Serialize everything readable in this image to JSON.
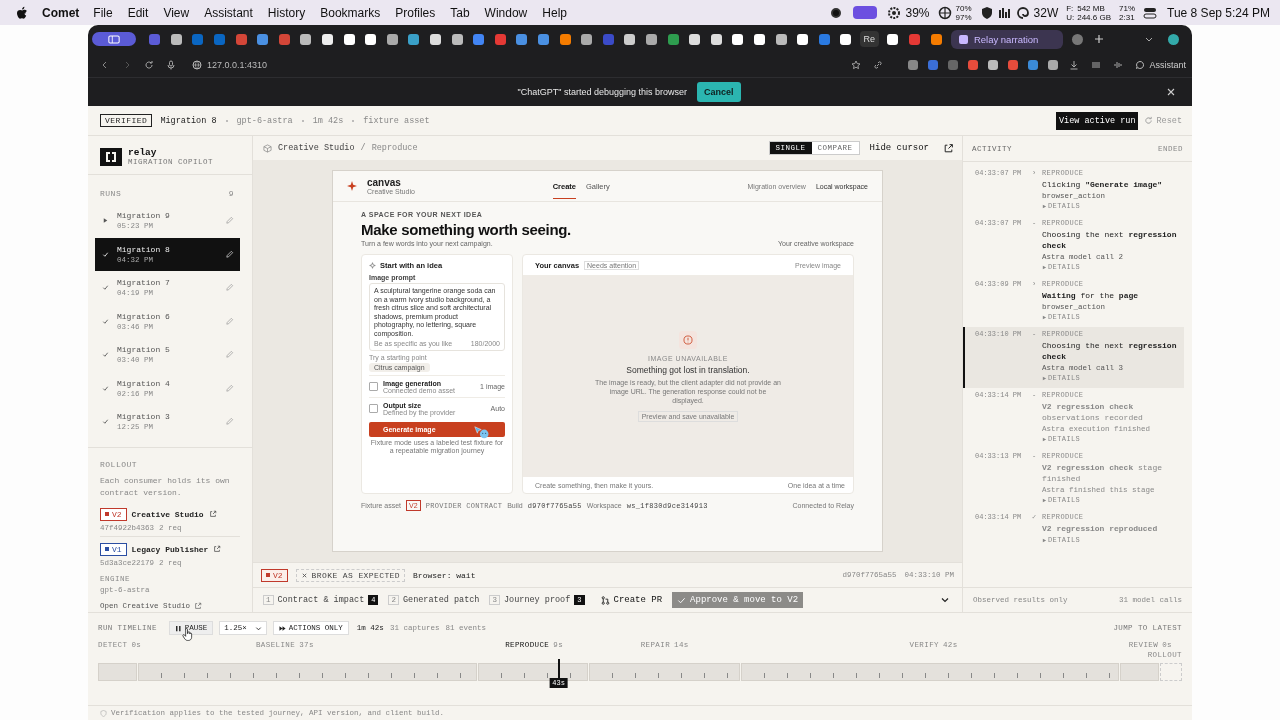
{
  "menubar": {
    "app": "Comet",
    "menus": [
      "File",
      "Edit",
      "View",
      "Assistant",
      "History",
      "Bookmarks",
      "Profiles",
      "Tab",
      "Window",
      "Help"
    ],
    "cpu": "39%",
    "mem": [
      "70%",
      "97%"
    ],
    "power": "32W",
    "storage": [
      {
        "label": "F:",
        "value": "542 MB"
      },
      {
        "label": "U:",
        "value": "244.6 GB"
      }
    ],
    "battery": [
      "71%",
      "2:31"
    ],
    "clock": "Tue 8 Sep  5:24 PM"
  },
  "browser": {
    "tabs": [
      {
        "label": "Re",
        "selected": false
      },
      {
        "label": "Relay narration",
        "selected": true
      }
    ],
    "url": "127.0.0.1:4310",
    "assistant": "Assistant",
    "banner": {
      "message": "\"ChatGPT\" started debugging this browser",
      "action": "Cancel"
    }
  },
  "header": {
    "badge": "VERIFIED",
    "run": "Migration 8",
    "meta": [
      "gpt-6-astra",
      "1m 42s",
      "fixture asset"
    ],
    "primary": "View active run",
    "secondary": "Reset"
  },
  "sidebar": {
    "brand": "relay",
    "tagline": "MIGRATION COPILOT",
    "runs_label": "RUNS",
    "runs_count": "9",
    "runs": [
      {
        "name": "Migration 9",
        "time": "05:23 PM",
        "kind": "running",
        "selected": false
      },
      {
        "name": "Migration 8",
        "time": "04:32 PM",
        "kind": "done",
        "selected": true
      },
      {
        "name": "Migration 7",
        "time": "04:19 PM",
        "kind": "done",
        "selected": false
      },
      {
        "name": "Migration 6",
        "time": "03:46 PM",
        "kind": "done",
        "selected": false
      },
      {
        "name": "Migration 5",
        "time": "03:40 PM",
        "kind": "done",
        "selected": false
      },
      {
        "name": "Migration 4",
        "time": "02:16 PM",
        "kind": "done",
        "selected": false
      },
      {
        "name": "Migration 3",
        "time": "12:25 PM",
        "kind": "done",
        "selected": false
      }
    ],
    "rollout_label": "ROLLOUT",
    "rollout_text": "Each consumer holds its own contract version.",
    "consumers": [
      {
        "version": "V2",
        "name": "Creative Studio",
        "hash": "47f4922b4363",
        "reqs": "2 req",
        "color": "#c0392b"
      },
      {
        "version": "V1",
        "name": "Legacy Publisher",
        "hash": "5d3a3ce22179",
        "reqs": "2 req",
        "color": "#2b4ea2"
      }
    ],
    "engine_label": "ENGINE",
    "engine": "gpt-6-astra",
    "open_link": "Open Creative Studio"
  },
  "center": {
    "breadcrumb": [
      "Creative Studio",
      "Reproduce"
    ],
    "breadcrumb_separator": "/",
    "views": [
      {
        "label": "SINGLE",
        "selected": true
      },
      {
        "label": "COMPARE",
        "selected": false
      }
    ],
    "hide_cursor": "Hide cursor",
    "preview": {
      "brand": "canvas",
      "brand_sub": "Creative Studio",
      "nav": [
        {
          "label": "Create",
          "selected": true
        },
        {
          "label": "Gallery",
          "selected": false
        }
      ],
      "links": [
        "Migration overview",
        "Local workspace"
      ],
      "eyebrow": "A SPACE FOR YOUR NEXT IDEA",
      "headline": "Make something worth seeing.",
      "subline": "Turn a few words into your next campaign.",
      "aside": "Your creative workspace",
      "idea_card": {
        "title": "Start with an idea",
        "prompt_label": "Image prompt",
        "prompt": "A sculptural tangerine orange soda can on a warm ivory studio background, a fresh citrus slice and soft architectural shadows, premium product photography, no lettering, square composition.",
        "hint": "Be as specific as you like",
        "count": "180/2000",
        "starter_label": "Try a starting point",
        "starter": "Citrus campaign",
        "options": [
          {
            "title": "Image generation",
            "sub": "Connected demo asset",
            "value": "1 image"
          },
          {
            "title": "Output size",
            "sub": "Defined by the provider",
            "value": "Auto"
          }
        ],
        "button": "Generate image",
        "note": "Fixture mode uses a labeled test fixture for a repeatable migration journey"
      },
      "canvas_card": {
        "title": "Your canvas",
        "tag": "Needs attention",
        "action": "Preview image",
        "error_eyebrow": "IMAGE UNAVAILABLE",
        "error_title": "Something got lost in translation.",
        "error_text": "The image is ready, but the client adapter did not provide an image URL. The generation response could not be displayed.",
        "error_chip": "Preview and save unavailable",
        "footer_left": "Create something, then make it yours.",
        "footer_right": "One idea at a time"
      },
      "footer": {
        "asset": "Fixture asset",
        "version": "V2",
        "contract": "PROVIDER CONTRACT",
        "build_label": "Build",
        "build": "d970f7765a55",
        "workspace_label": "Workspace",
        "workspace": "ws_1f830d9ce314913",
        "connected": "Connected to Relay"
      }
    },
    "status": {
      "version": "V2",
      "result": "BROKE AS EXPECTED",
      "browser": "Browser: wait",
      "hash": "d970f7765a55",
      "time": "04:33:10 PM"
    },
    "steps": [
      {
        "num": "1",
        "label": "Contract & impact",
        "count": "4"
      },
      {
        "num": "2",
        "label": "Generated patch"
      },
      {
        "num": "3",
        "label": "Journey proof",
        "count": "3"
      }
    ],
    "create_pr": "Create PR",
    "approve": "Approve & move to V2"
  },
  "activity": {
    "title": "ACTIVITY",
    "state": "ENDED",
    "items": [
      {
        "time": "04:33:07 PM",
        "marker": "›",
        "phase": "REPRODUCE",
        "text": "Clicking **\"Generate image\"**",
        "sub": "browser_action",
        "details": "DETAILS",
        "kind": "past",
        "selected": false
      },
      {
        "time": "04:33:07 PM",
        "marker": "-",
        "phase": "REPRODUCE",
        "text": "Choosing the next **regression check**",
        "sub": "Astra model call 2",
        "details": "DETAILS",
        "kind": "past",
        "selected": false
      },
      {
        "time": "04:33:09 PM",
        "marker": "›",
        "phase": "REPRODUCE",
        "text": "**Waiting** for the **page**",
        "sub": "browser_action",
        "details": "DETAILS",
        "kind": "past",
        "selected": false
      },
      {
        "time": "04:33:10 PM",
        "marker": "-",
        "phase": "REPRODUCE",
        "text": "Choosing the next **regression check**",
        "sub": "Astra model call 3",
        "details": "DETAILS",
        "kind": "past",
        "selected": true
      },
      {
        "time": "04:33:14 PM",
        "marker": "-",
        "phase": "REPRODUCE",
        "text": "**V2 regression check** observations recorded",
        "sub": "Astra execution finished",
        "details": "DETAILS",
        "kind": "future",
        "selected": false
      },
      {
        "time": "04:33:13 PM",
        "marker": "-",
        "phase": "REPRODUCE",
        "text": "**V2 regression check** stage finished",
        "sub": "Astra finished this stage",
        "details": "DETAILS",
        "kind": "future",
        "selected": false
      },
      {
        "time": "04:33:14 PM",
        "marker": "✓",
        "phase": "REPRODUCE",
        "text": "**V2 regression reproduced**",
        "details": "DETAILS",
        "kind": "future",
        "selected": false
      }
    ],
    "footer_left": "Observed results only",
    "footer_right": "31 model calls"
  },
  "timeline": {
    "label": "RUN TIMELINE",
    "pause": "PAUSE",
    "speed": "1.25×",
    "filter": "ACTIONS ONLY",
    "duration": "1m 42s",
    "captures": "31 captures",
    "events": "81 events",
    "jump": "JUMP TO LATEST",
    "phases": [
      {
        "label": "DETECT",
        "duration": "0s",
        "kind": "recorded",
        "selected": false
      },
      {
        "label": "BASELINE",
        "duration": "37s",
        "kind": "recorded",
        "selected": false
      },
      {
        "label": "REPRODUCE",
        "duration": "9s",
        "kind": "recorded",
        "selected": true
      },
      {
        "label": "REPAIR",
        "duration": "14s",
        "kind": "recorded",
        "selected": false
      },
      {
        "label": "VERIFY",
        "duration": "42s",
        "kind": "recorded",
        "selected": false
      },
      {
        "label": "REVIEW",
        "duration": "0s",
        "kind": "recorded",
        "selected": false
      },
      {
        "label": "ROLLOUT",
        "kind": "pending",
        "selected": false
      }
    ],
    "playhead": {
      "label": "43s",
      "level": 0.424
    },
    "footer": "Verification applies to the tested journey, API version, and client build."
  }
}
